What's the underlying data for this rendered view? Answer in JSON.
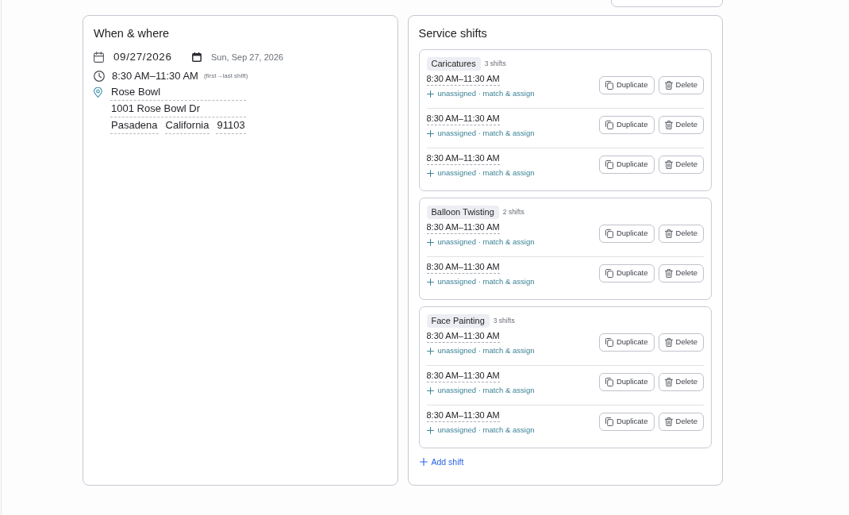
{
  "when_where": {
    "title": "When & where",
    "date": {
      "value": "09/27/2026",
      "display": "Sun, Sep 27, 2026"
    },
    "time": {
      "range": "8:30 AM–11:30 AM",
      "note": "(first→last shift)"
    },
    "location": {
      "venue": "Rose Bowl",
      "street": "1001 Rose Bowl Dr",
      "city": "Pasadena",
      "state": "California",
      "zip": "91103"
    }
  },
  "service_shifts": {
    "title": "Service shifts",
    "groups": [
      {
        "name": "Caricatures",
        "count": "3 shifts",
        "shifts": [
          {
            "time": "8:30 AM–11:30 AM",
            "assignment": "unassigned · match & assign",
            "actions": [
              {
                "kind": "duplicate",
                "label": "Duplicate"
              },
              {
                "kind": "delete",
                "label": "Delete"
              }
            ]
          },
          {
            "time": "8:30 AM–11:30 AM",
            "assignment": "unassigned · match & assign",
            "actions": [
              {
                "kind": "duplicate",
                "label": "Duplicate"
              },
              {
                "kind": "delete",
                "label": "Delete"
              }
            ]
          },
          {
            "time": "8:30 AM–11:30 AM",
            "assignment": "unassigned · match & assign",
            "actions": [
              {
                "kind": "duplicate",
                "label": "Duplicate"
              },
              {
                "kind": "delete",
                "label": "Delete"
              }
            ]
          }
        ]
      },
      {
        "name": "Balloon Twisting",
        "count": "2 shifts",
        "shifts": [
          {
            "time": "8:30 AM–11:30 AM",
            "assignment": "unassigned · match & assign",
            "actions": [
              {
                "kind": "duplicate",
                "label": "Duplicate"
              },
              {
                "kind": "delete",
                "label": "Delete"
              }
            ]
          },
          {
            "time": "8:30 AM–11:30 AM",
            "assignment": "unassigned · match & assign",
            "actions": [
              {
                "kind": "duplicate",
                "label": "Duplicate"
              },
              {
                "kind": "delete",
                "label": "Delete"
              }
            ]
          }
        ]
      },
      {
        "name": "Face Painting",
        "count": "3 shifts",
        "shifts": [
          {
            "time": "8:30 AM–11:30 AM",
            "assignment": "unassigned · match & assign",
            "actions": [
              {
                "kind": "duplicate",
                "label": "Duplicate"
              },
              {
                "kind": "delete",
                "label": "Delete"
              }
            ]
          },
          {
            "time": "8:30 AM–11:30 AM",
            "assignment": "unassigned · match & assign",
            "actions": [
              {
                "kind": "duplicate",
                "label": "Duplicate"
              },
              {
                "kind": "delete",
                "label": "Delete"
              }
            ]
          },
          {
            "time": "8:30 AM–11:30 AM",
            "assignment": "unassigned · match & assign",
            "actions": [
              {
                "kind": "duplicate",
                "label": "Duplicate"
              },
              {
                "kind": "delete",
                "label": "Delete"
              }
            ]
          }
        ]
      }
    ],
    "add_label": "Add shift"
  }
}
